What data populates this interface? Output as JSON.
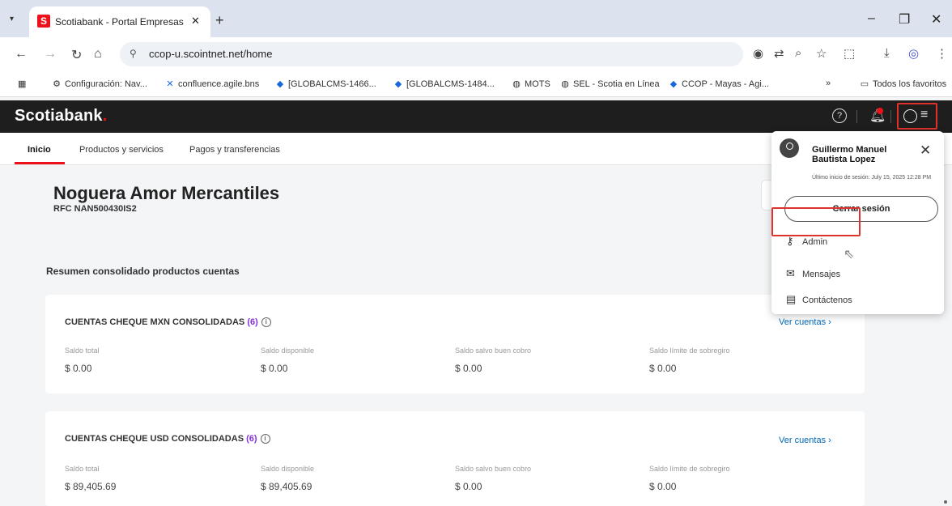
{
  "browser": {
    "tab_title": "Scotiabank - Portal Empresas",
    "tab_close": "✕",
    "new_tab": "+",
    "url": "ccop-u.scointnet.net/home",
    "bookmarks": [
      {
        "label": "Configuración: Nav...",
        "icon": "gear-icon"
      },
      {
        "label": "confluence.agile.bns",
        "icon": "confluence-icon"
      },
      {
        "label": "[GLOBALCMS-1466...",
        "icon": "jira-icon"
      },
      {
        "label": "[GLOBALCMS-1484...",
        "icon": "jira-icon"
      },
      {
        "label": "MOTS",
        "icon": "globe-icon"
      },
      {
        "label": "SEL - Scotia en Línea",
        "icon": "globe-icon"
      },
      {
        "label": "CCOP - Mayas - Agi...",
        "icon": "jira-icon"
      }
    ],
    "bookmarks_overflow": "»",
    "all_bookmarks": "Todos los favoritos"
  },
  "header": {
    "logo": "Scotiabank",
    "logo_dot": ".",
    "help": "?"
  },
  "subnav": {
    "items": [
      "Inicio",
      "Productos y servicios",
      "Pagos y transferencias"
    ]
  },
  "main": {
    "company_name": "Noguera Amor Mercantiles",
    "rfc": "RFC NAN500430IS2",
    "summary_title": "Resumen consolidado productos cuentas",
    "cards": [
      {
        "title": "CUENTAS CHEQUE MXN CONSOLIDADAS",
        "count": "(6)",
        "link": "Ver cuentas ›",
        "fields": [
          {
            "label": "Saldo total",
            "value": "$ 0.00"
          },
          {
            "label": "Saldo disponible",
            "value": "$ 0.00"
          },
          {
            "label": "Saldo salvo buen cobro",
            "value": "$ 0.00"
          },
          {
            "label": "Saldo límite de sobregiro",
            "value": "$ 0.00"
          }
        ]
      },
      {
        "title": "CUENTAS CHEQUE USD CONSOLIDADAS",
        "count": "(6)",
        "link": "Ver cuentas ›",
        "fields": [
          {
            "label": "Saldo total",
            "value": "$ 89,405.69"
          },
          {
            "label": "Saldo disponible",
            "value": "$ 89,405.69"
          },
          {
            "label": "Saldo salvo buen cobro",
            "value": "$ 0.00"
          },
          {
            "label": "Saldo límite de sobregiro",
            "value": "$ 0.00"
          }
        ]
      }
    ]
  },
  "profile_panel": {
    "name": "Guillermo Manuel Bautista Lopez",
    "last_login": "Último inicio de sesión: July 15, 2025 12:28 PM",
    "logout": "Cerrar sesión",
    "close": "✕",
    "menu": [
      {
        "label": "Admin",
        "icon": "key-icon"
      },
      {
        "label": "Mensajes",
        "icon": "envelope-icon"
      },
      {
        "label": "Contáctenos",
        "icon": "chat-icon"
      }
    ]
  }
}
